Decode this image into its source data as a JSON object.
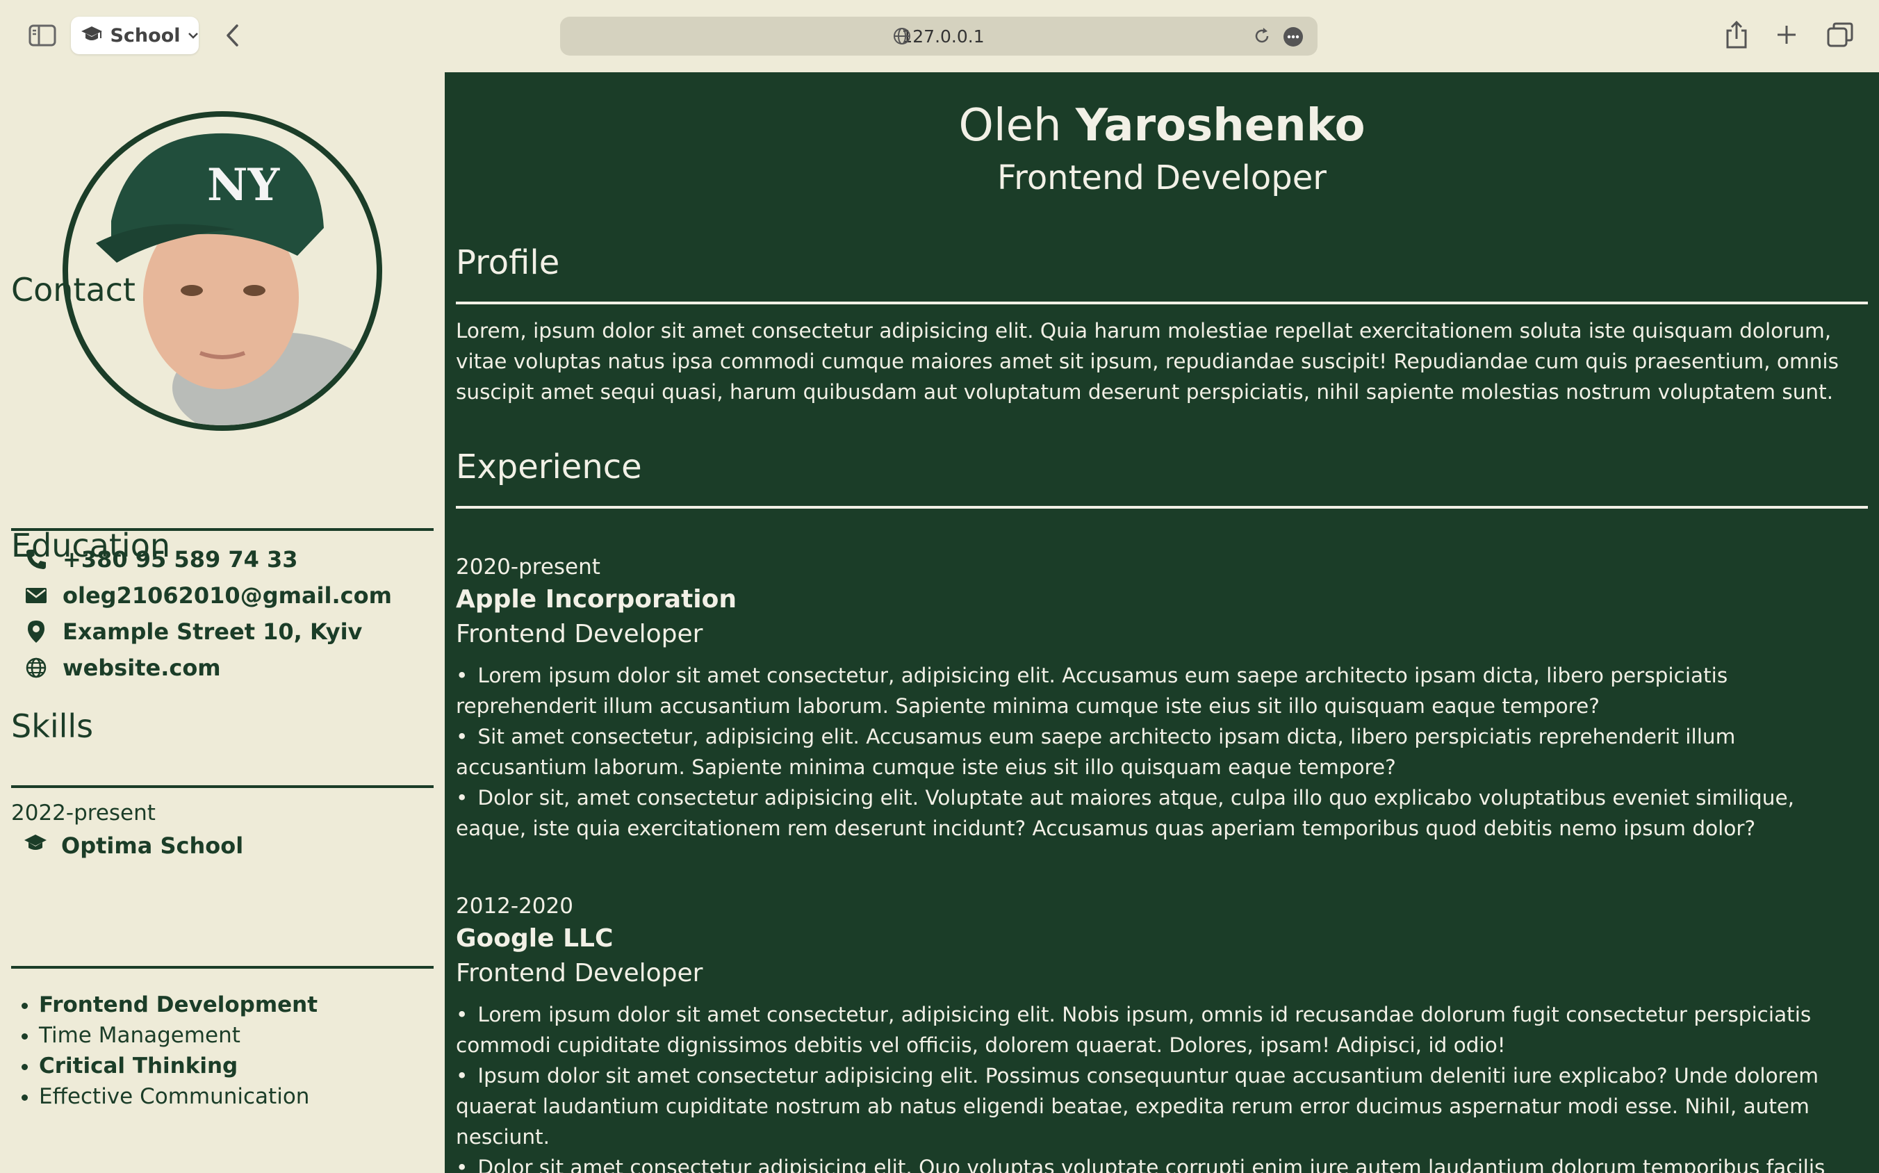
{
  "browser": {
    "profile_label": "School",
    "url": "127.0.0.1"
  },
  "resume": {
    "first_name": "Oleh",
    "last_name": "Yaroshenko",
    "title": "Frontend Developer",
    "contact": {
      "heading": "Contact",
      "phone": "+380 95 589 74 33",
      "email": "oleg21062010@gmail.com",
      "address": "Example Street 10, Kyiv",
      "website": "website.com"
    },
    "education": {
      "heading": "Education",
      "year": "2022-present",
      "school": "Optima School"
    },
    "skills": {
      "heading": "Skills",
      "items": [
        "Frontend Development",
        "Time Management",
        "Critical Thinking",
        "Effective Communication"
      ]
    },
    "profile": {
      "heading": "Profile",
      "text": "Lorem, ipsum dolor sit amet consectetur adipisicing elit. Quia harum molestiae repellat exercitationem soluta iste quisquam dolorum, vitae voluptas natus ipsa commodi cumque maiores amet sit ipsum, repudiandae suscipit! Repudiandae cum quis praesentium, omnis suscipit amet sequi quasi, harum quibusdam aut voluptatum deserunt perspiciatis, nihil sapiente molestias nostrum voluptatem sunt."
    },
    "experience": {
      "heading": "Experience",
      "jobs": [
        {
          "years": "2020-present",
          "company": "Apple Incorporation",
          "role": "Frontend Developer",
          "bullets": [
            "Lorem ipsum dolor sit amet consectetur, adipisicing elit. Accusamus eum saepe architecto ipsam dicta, libero perspiciatis reprehenderit illum accusantium laborum. Sapiente minima cumque iste eius sit illo quisquam eaque tempore?",
            "Sit amet consectetur, adipisicing elit. Accusamus eum saepe architecto ipsam dicta, libero perspiciatis reprehenderit illum accusantium laborum. Sapiente minima cumque iste eius sit illo quisquam eaque tempore?",
            "Dolor sit, amet consectetur adipisicing elit. Voluptate aut maiores atque, culpa illo quo explicabo voluptatibus eveniet similique, eaque, iste quia exercitationem rem deserunt incidunt? Accusamus quas aperiam temporibus quod debitis nemo ipsum dolor?"
          ]
        },
        {
          "years": "2012-2020",
          "company": "Google LLC",
          "role": "Frontend Developer",
          "bullets": [
            "Lorem ipsum dolor sit amet consectetur, adipisicing elit. Nobis ipsum, omnis id recusandae dolorum fugit consectetur perspiciatis commodi cupiditate dignissimos debitis vel officiis, dolorem quaerat. Dolores, ipsam! Adipisci, id odio!",
            "Ipsum dolor sit amet consectetur adipisicing elit. Possimus consequuntur quae accusantium deleniti iure explicabo? Unde dolorem quaerat laudantium cupiditate nostrum ab natus eligendi beatae, expedita rerum error ducimus aspernatur modi esse. Nihil, autem nesciunt.",
            "Dolor sit amet consectetur adipisicing elit. Quo voluptas voluptate corrupti enim iure autem laudantium dolorum temporibus facilis aperiam totam, necessitatibus, pariatur ut ab! Praesentium consequuntur provident eius ratione."
          ]
        }
      ]
    }
  }
}
